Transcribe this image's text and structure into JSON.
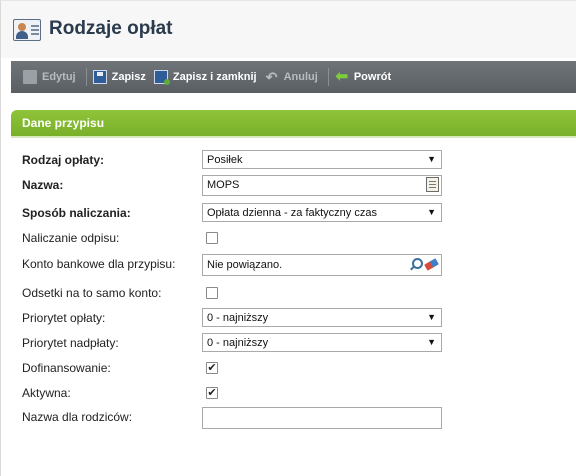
{
  "header": {
    "title": "Rodzaje opłat"
  },
  "toolbar": {
    "edit": "Edytuj",
    "save": "Zapisz",
    "save_close": "Zapisz i zamknij",
    "cancel": "Anuluj",
    "back": "Powrót"
  },
  "section": {
    "title": "Dane przypisu"
  },
  "form": {
    "fee_type": {
      "label": "Rodzaj opłaty:",
      "value": "Posiłek"
    },
    "name": {
      "label": "Nazwa:",
      "value": "MOPS"
    },
    "calc_method": {
      "label": "Sposób naliczania:",
      "value": "Opłata dzienna - za faktyczny czas"
    },
    "deduction": {
      "label": "Naliczanie odpisu:",
      "checked": false
    },
    "bank_account": {
      "label": "Konto bankowe dla przypisu:",
      "value": "Nie powiązano."
    },
    "interest_same_account": {
      "label": "Odsetki na to samo konto:",
      "checked": false
    },
    "fee_priority": {
      "label": "Priorytet opłaty:",
      "value": "0 - najniższy"
    },
    "overpay_priority": {
      "label": "Priorytet nadpłaty:",
      "value": "0 - najniższy"
    },
    "cofinancing": {
      "label": "Dofinansowanie:",
      "checked": true
    },
    "active": {
      "label": "Aktywna:",
      "checked": true
    },
    "parents_name": {
      "label": "Nazwa dla rodziców:",
      "value": ""
    }
  },
  "check_glyph": "✔"
}
